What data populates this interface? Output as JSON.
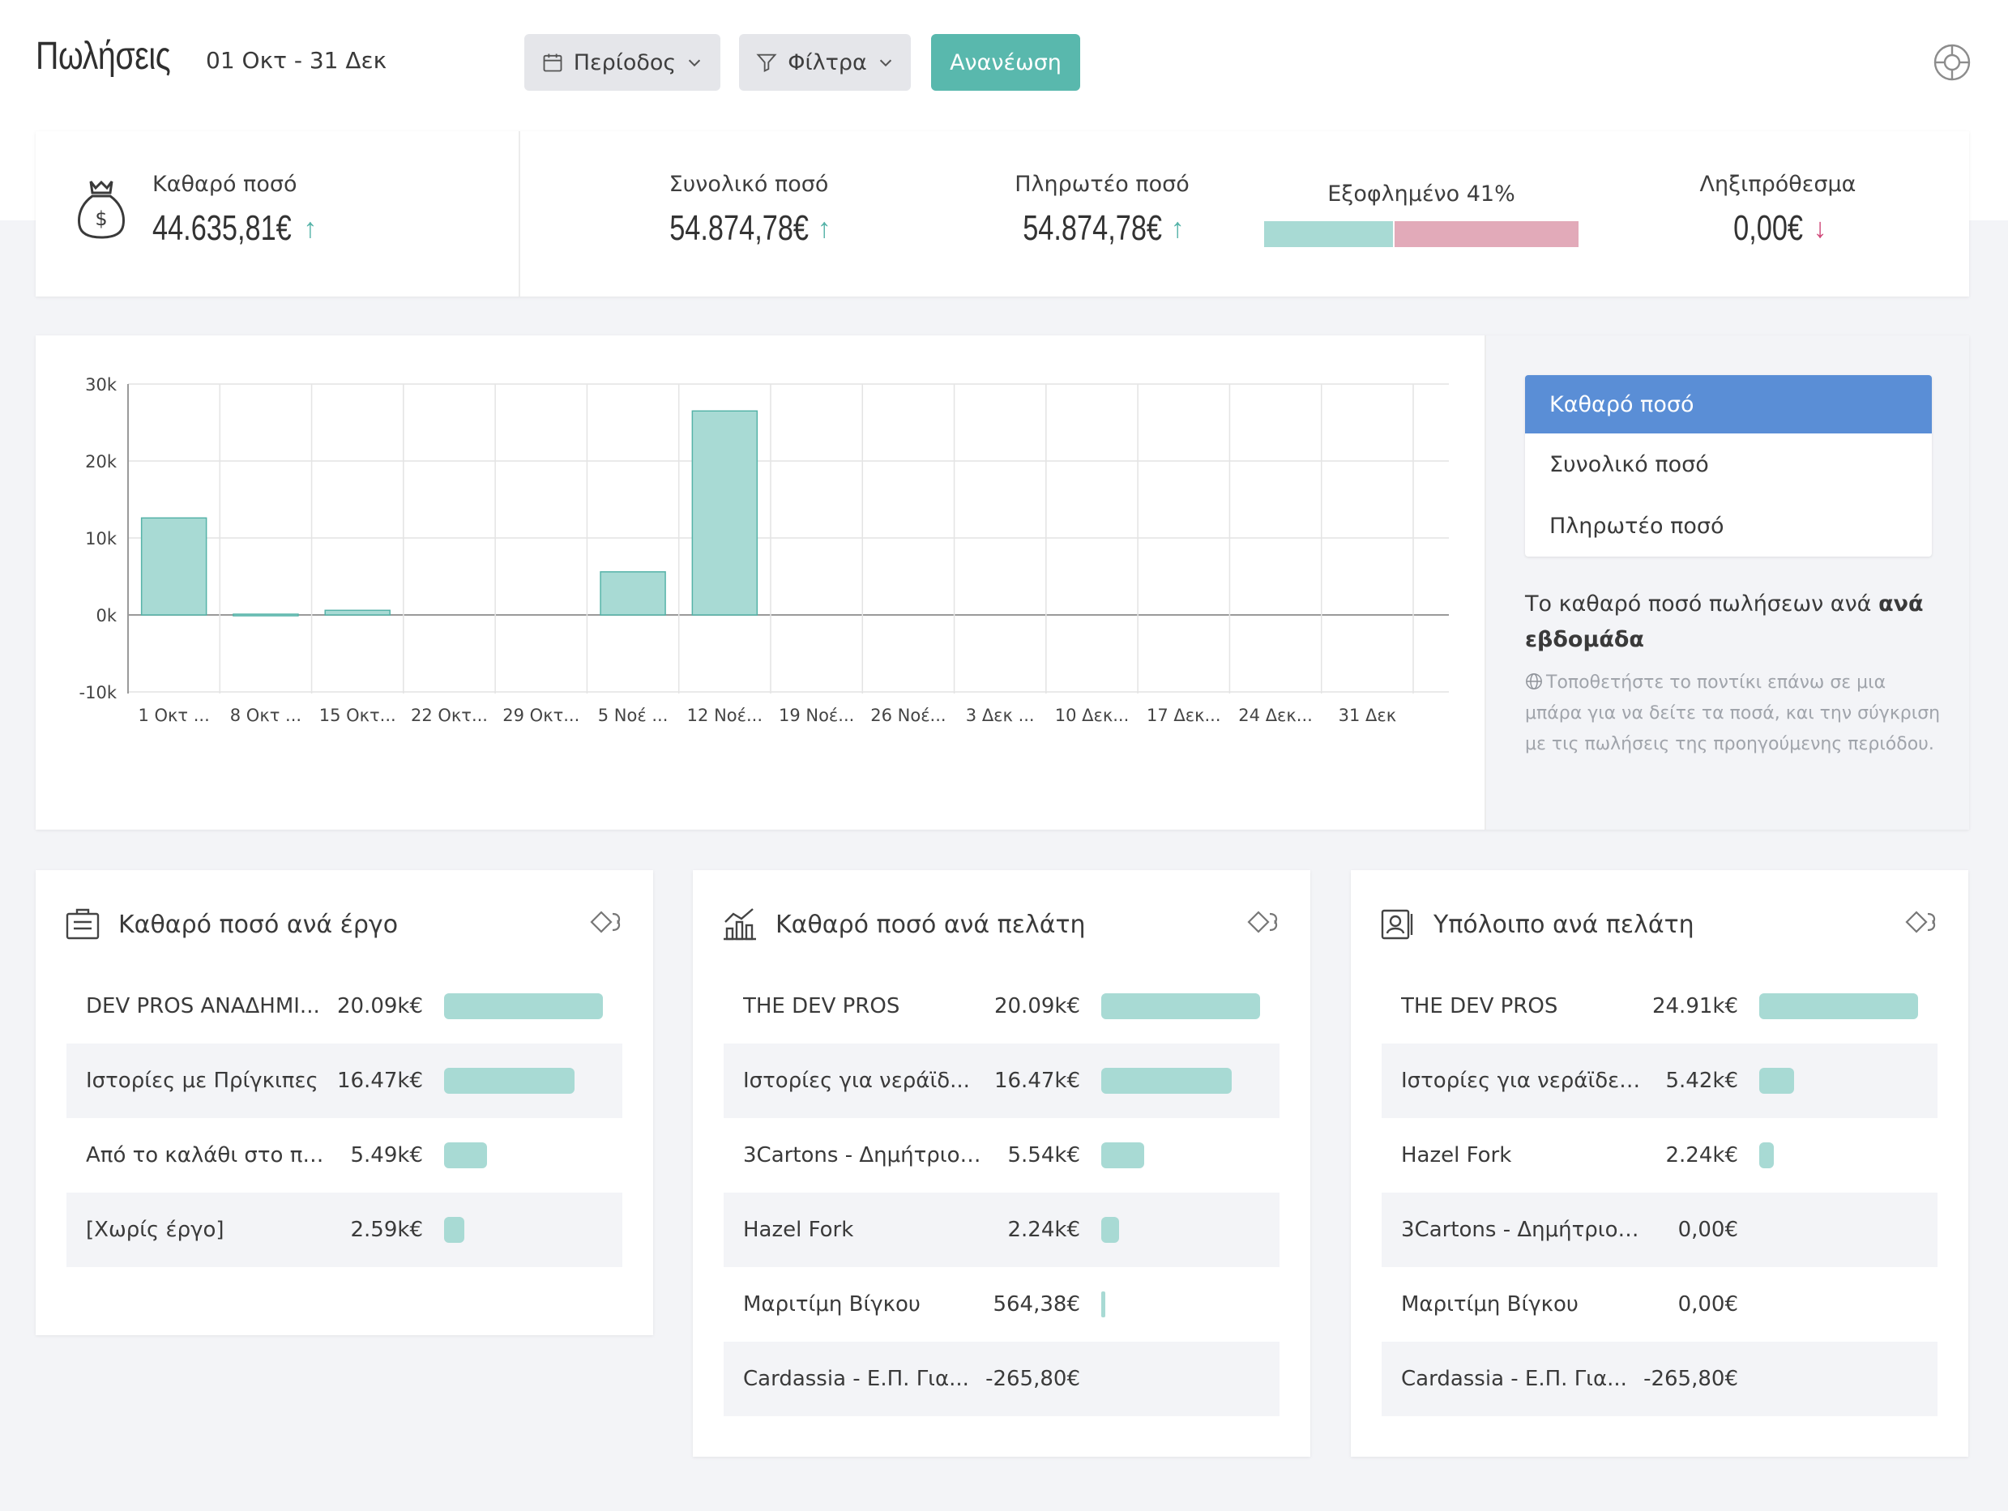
{
  "header": {
    "title": "Πωλήσεις",
    "date_range": "01 Οκτ  - 31 Δεκ",
    "period_label": "Περίοδος",
    "filters_label": "Φίλτρα",
    "refresh_label": "Ανανέωση",
    "accent": "#59b8ad"
  },
  "kpis": {
    "net_label": "Καθαρό ποσό",
    "net_value": "44.635,81€",
    "net_trend": "up",
    "total_label": "Συνολικό ποσό",
    "total_value": "54.874,78€",
    "total_trend": "up",
    "payable_label": "Πληρωτέο ποσό",
    "payable_value": "54.874,78€",
    "payable_trend": "up",
    "paid_label": "Εξοφλημένο 41%",
    "paid_percent": 41,
    "overdue_label": "Ληξιπρόθεσμα",
    "overdue_value": "0,00€",
    "overdue_trend": "down",
    "arrow_up": "↑",
    "arrow_down": "↓"
  },
  "chart_data": {
    "type": "bar",
    "categories": [
      "1 Οκτ ...",
      "8 Οκτ ...",
      "15 Οκτ...",
      "22 Οκτ...",
      "29 Οκτ...",
      "5 Νοέ ...",
      "12 Νοέ...",
      "19 Νοέ...",
      "26 Νοέ...",
      "3 Δεκ ...",
      "10 Δεκ...",
      "17 Δεκ...",
      "24 Δεκ...",
      "31 Δεκ"
    ],
    "values": [
      12600,
      100,
      600,
      0,
      0,
      5600,
      26500,
      0,
      0,
      0,
      0,
      0,
      0,
      0
    ],
    "ylim": [
      -10000,
      30000
    ],
    "yticks": [
      -10000,
      0,
      10000,
      20000,
      30000
    ],
    "ytick_labels": [
      "-10k",
      "0k",
      "10k",
      "20k",
      "30k"
    ],
    "grid": true,
    "bar_color": "#a8dad4",
    "bar_border": "#55b3a8"
  },
  "chart_side": {
    "metrics": [
      "Καθαρό ποσό",
      "Συνολικό ποσό",
      "Πληρωτέο ποσό"
    ],
    "active_metric": 0,
    "desc_text": "Το καθαρό ποσό πωλήσεων ανά ",
    "desc_bold": "ανά εβδομάδα",
    "hint": "Τοποθετήστε το ποντίκι επάνω σε μια μπάρα για να δείτε τα ποσά, και την σύγκριση με τις πωλήσεις της προηγούμενης περιόδου."
  },
  "cards": [
    {
      "title": "Καθαρό ποσό ανά έργο",
      "icon": "briefcase-icon",
      "rows": [
        {
          "name": "DEV PROS ΑΝΑΔΗΜΙ...",
          "value": "20.09k€",
          "fraction": 1.0
        },
        {
          "name": "Ιστορίες με Πρίγκιπες",
          "value": "16.47k€",
          "fraction": 0.82
        },
        {
          "name": "Από το καλάθι στο πρ...",
          "value": "5.49k€",
          "fraction": 0.27
        },
        {
          "name": "[Χωρίς έργο]",
          "value": "2.59k€",
          "fraction": 0.13
        }
      ]
    },
    {
      "title": "Καθαρό ποσό ανά πελάτη",
      "icon": "bar-chart-icon",
      "rows": [
        {
          "name": "THE DEV PROS",
          "value": "20.09k€",
          "fraction": 1.0
        },
        {
          "name": "Ιστορίες για νεράϊδ...",
          "value": "16.47k€",
          "fraction": 0.82
        },
        {
          "name": "3Cartons - Δημήτριος...",
          "value": "5.54k€",
          "fraction": 0.27
        },
        {
          "name": "Hazel Fork",
          "value": "2.24k€",
          "fraction": 0.11
        },
        {
          "name": "Μαριτίμη Βίγκου",
          "value": "564,38€",
          "fraction": 0.028
        },
        {
          "name": "Cardassia - Ε.Π. Για...",
          "value": "-265,80€",
          "fraction": 0
        }
      ]
    },
    {
      "title": "Υπόλοιπο ανά πελάτη",
      "icon": "contact-card-icon",
      "rows": [
        {
          "name": "THE DEV PROS",
          "value": "24.91k€",
          "fraction": 1.0
        },
        {
          "name": "Ιστορίες για νεράϊδες...",
          "value": "5.42k€",
          "fraction": 0.22
        },
        {
          "name": "Hazel Fork",
          "value": "2.24k€",
          "fraction": 0.09
        },
        {
          "name": "3Cartons - Δημήτριος ...",
          "value": "0,00€",
          "fraction": 0
        },
        {
          "name": "Μαριτίμη Βίγκου",
          "value": "0,00€",
          "fraction": 0
        },
        {
          "name": "Cardassia - Ε.Π. Για...",
          "value": "-265,80€",
          "fraction": 0
        }
      ]
    }
  ]
}
